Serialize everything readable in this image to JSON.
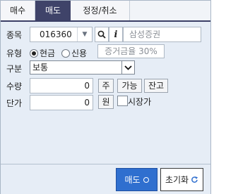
{
  "tabs": [
    {
      "label": "매수",
      "active": false
    },
    {
      "label": "매도",
      "active": true
    },
    {
      "label": "정정/취소",
      "active": false
    }
  ],
  "stock": {
    "label": "종목",
    "code": "016360",
    "name": "삼성증권",
    "icons": {
      "dropdown": "chevron-down-icon",
      "search": "search-icon",
      "info": "info-icon"
    }
  },
  "order_type": {
    "label": "유형",
    "options": [
      {
        "label": "현금",
        "selected": true
      },
      {
        "label": "신용",
        "selected": false
      }
    ],
    "margin_rate": "증거금율 30%"
  },
  "category": {
    "label": "구분",
    "selected": "보통"
  },
  "quantity": {
    "label": "수량",
    "value": "0",
    "unit_button": "주",
    "available_button": "가능",
    "balance_button": "잔고"
  },
  "price": {
    "label": "단가",
    "value": "0",
    "unit_button": "원",
    "market_price_label": "시장가",
    "market_price_checked": false
  },
  "actions": {
    "submit_label": "매도",
    "reset_label": "초기화"
  },
  "colors": {
    "tab_active": "#3f4369",
    "panel_bg": "#e6edf6",
    "submit_bg": "#2f6fcf"
  }
}
